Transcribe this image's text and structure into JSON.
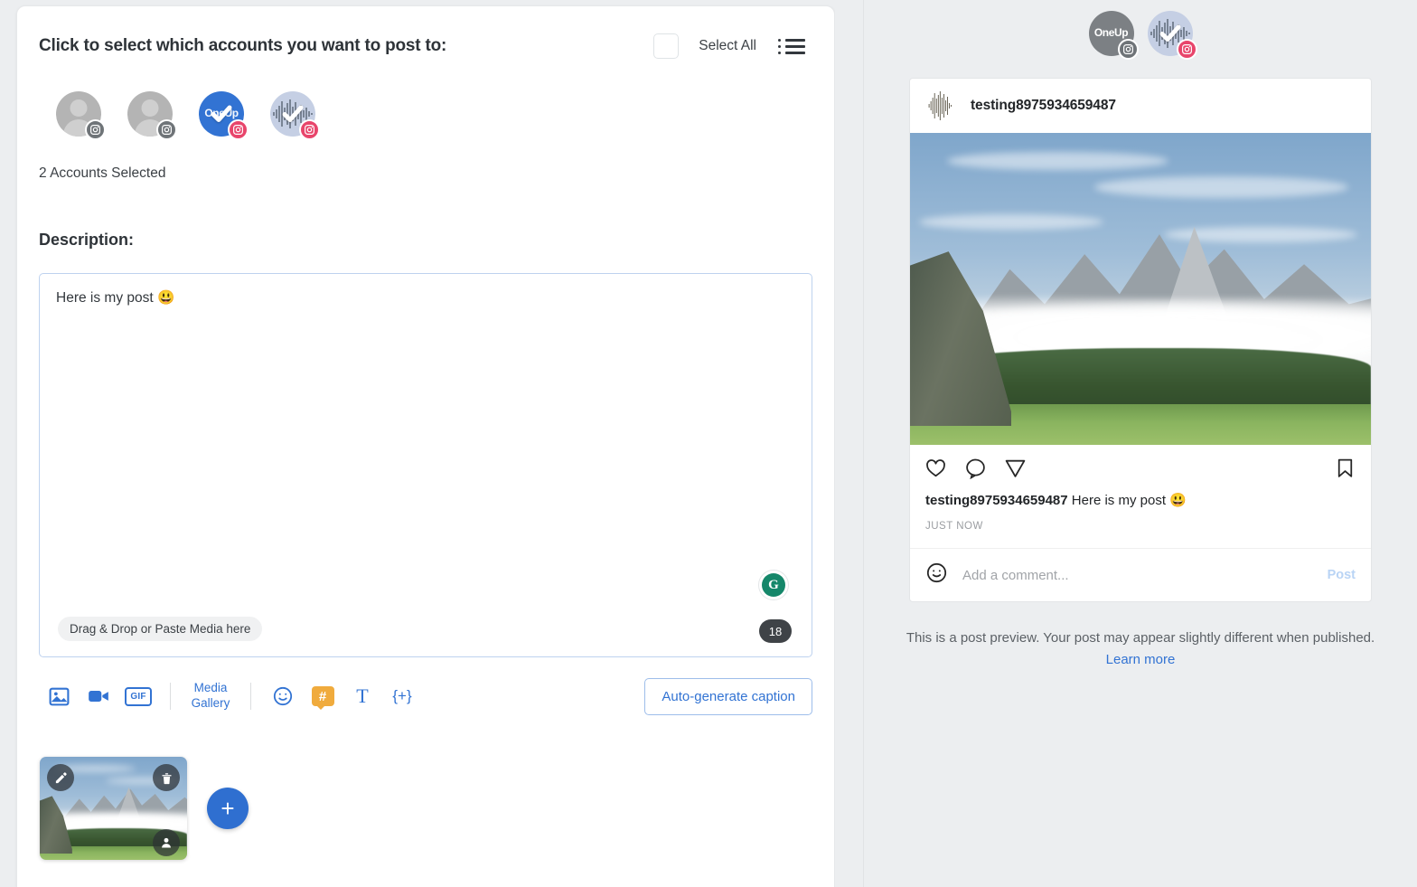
{
  "composer": {
    "title": "Click to select which accounts you want to post to:",
    "select_all_label": "Select All",
    "list_view_icon": "list-view-icon",
    "accounts": [
      {
        "name": "account-1",
        "type": "placeholder",
        "platform": "instagram",
        "selected": false,
        "badge_color": "#6f7478"
      },
      {
        "name": "account-2",
        "type": "placeholder",
        "platform": "instagram",
        "selected": false,
        "badge_color": "#6f7478"
      },
      {
        "name": "account-3",
        "type": "oneup-logo",
        "label": "OneUp",
        "platform": "instagram",
        "selected": true,
        "badge_color": "#e8456b"
      },
      {
        "name": "account-4",
        "type": "waveform",
        "platform": "instagram",
        "selected": true,
        "badge_color": "#e8456b"
      }
    ],
    "selected_count_text": "2 Accounts Selected",
    "description_label": "Description:",
    "description_value": "Here is my post 😃",
    "drag_drop_hint": "Drag & Drop or Paste Media here",
    "character_count": "18",
    "grammarly_letter": "G",
    "toolbar": {
      "image_icon": "image-icon",
      "video_icon": "video-icon",
      "gif_label": "GIF",
      "media_gallery_line1": "Media",
      "media_gallery_line2": "Gallery",
      "emoji_icon": "emoji-icon",
      "hashtag_label": "#",
      "text_label": "T",
      "variable_label": "{+}",
      "auto_generate_label": "Auto-generate caption"
    },
    "media": {
      "edit_icon": "edit-pencil-icon",
      "delete_icon": "trash-icon",
      "tag_icon": "tag-person-icon",
      "add_label": "+"
    }
  },
  "preview": {
    "header_avatars": [
      {
        "name": "preview-avatar-oneup",
        "label": "OneUp",
        "active": false,
        "badge_color": "#6f7478"
      },
      {
        "name": "preview-avatar-testing",
        "active": true,
        "badge_color": "#e8456b"
      }
    ],
    "username": "testing8975934659487",
    "actions": {
      "like_icon": "heart-icon",
      "comment_icon": "comment-icon",
      "share_icon": "share-paper-plane-icon",
      "save_icon": "bookmark-icon"
    },
    "caption_user": "testing8975934659487",
    "caption_text": "Here is my post 😃",
    "timestamp": "JUST NOW",
    "comment_placeholder": "Add a comment...",
    "comment_post_label": "Post",
    "disclaimer_text": "This is a post preview. Your post may appear slightly different when published.",
    "learn_more_label": "Learn more"
  },
  "colors": {
    "accent_blue": "#3273d3",
    "instagram_pink": "#e8456b",
    "hashtag_amber": "#f0ab3d",
    "grammarly_green": "#15876a",
    "page_background": "#eceef0"
  }
}
